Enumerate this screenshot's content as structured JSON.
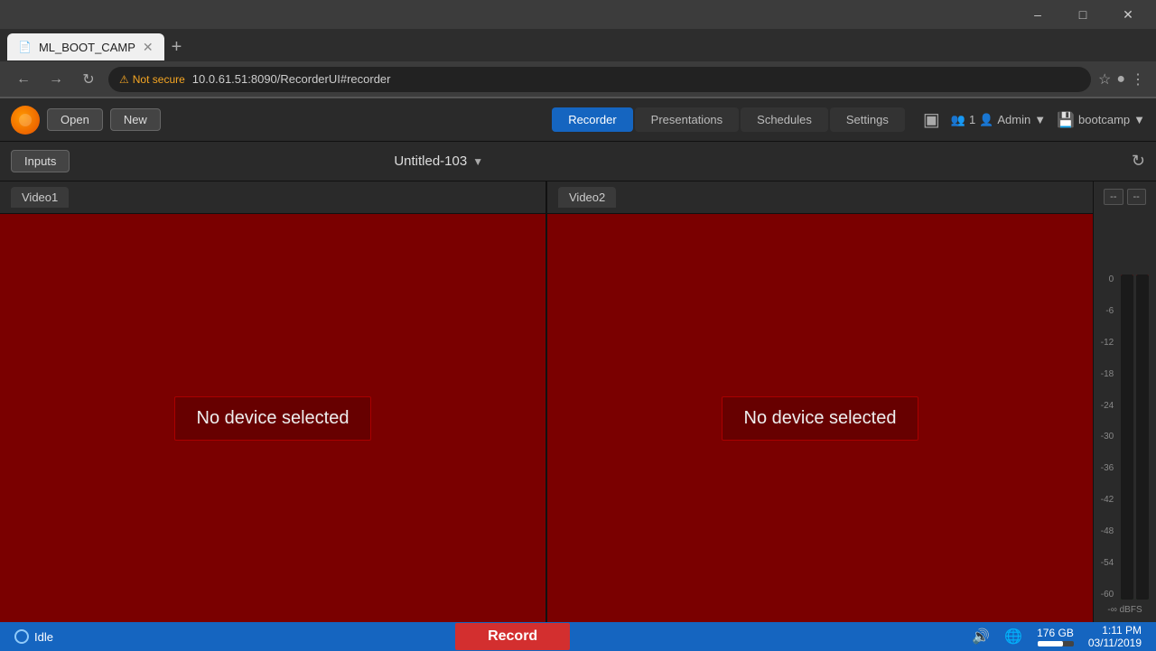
{
  "browser": {
    "tab_title": "ML_BOOT_CAMP",
    "url_security": "Not secure",
    "url_address": "10.0.61.51:8090/RecorderUI#recorder",
    "new_tab_label": "+"
  },
  "nav": {
    "open_label": "Open",
    "new_label": "New",
    "tabs": [
      {
        "label": "Recorder",
        "active": true
      },
      {
        "label": "Presentations",
        "active": false
      },
      {
        "label": "Schedules",
        "active": false
      },
      {
        "label": "Settings",
        "active": false
      }
    ],
    "users_count": "1",
    "admin_label": "Admin",
    "server_label": "bootcamp"
  },
  "recorder": {
    "inputs_label": "Inputs",
    "title": "Untitled-103",
    "video1_label": "Video1",
    "video2_label": "Video2",
    "no_device_1": "No device selected",
    "no_device_2": "No device selected",
    "vu": {
      "btn1": "--",
      "btn2": "--",
      "scale": [
        "0",
        "-6",
        "-12",
        "-18",
        "-24",
        "-30",
        "-36",
        "-42",
        "-48",
        "-54",
        "-60"
      ],
      "dbfs_label": "-∞ dBFS"
    }
  },
  "statusbar": {
    "idle_label": "Idle",
    "record_label": "Record",
    "storage_label": "176 GB",
    "time_label": "1:11 PM",
    "date_label": "03/11/2019"
  }
}
